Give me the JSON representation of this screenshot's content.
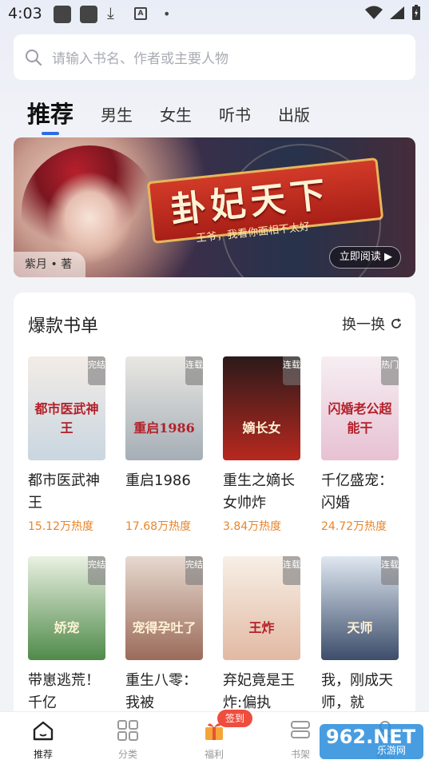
{
  "status_bar": {
    "time": "4:03"
  },
  "search": {
    "placeholder": "请输入书名、作者或主要人物"
  },
  "tabs": [
    {
      "label": "推荐",
      "active": true
    },
    {
      "label": "男生"
    },
    {
      "label": "女生"
    },
    {
      "label": "听书"
    },
    {
      "label": "出版"
    }
  ],
  "banner": {
    "title": "卦妃天下",
    "subtitle": "王爷，我看你面相不太好",
    "author": "紫月 • 著",
    "button_label": "立即阅读"
  },
  "booklist": {
    "title": "爆款书单",
    "refresh_label": "换一换",
    "books": [
      {
        "name": "都市医武神王",
        "heat": "15.12万热度",
        "badge": "完结",
        "cover_text": "都市医武神王",
        "cover_colors": [
          "#f3ece6",
          "#c9d6e0"
        ]
      },
      {
        "name": "重启1986",
        "heat": "17.68万热度",
        "badge": "连载",
        "cover_text": "重启1986",
        "cover_colors": [
          "#e9e7e2",
          "#a5aeb6"
        ]
      },
      {
        "name": "重生之嫡长女帅炸",
        "heat": "3.84万热度",
        "badge": "连载",
        "cover_text": "嫡长女",
        "cover_colors": [
          "#2a1a1a",
          "#b8281f"
        ]
      },
      {
        "name": "千亿盛宠：闪婚",
        "heat": "24.72万热度",
        "badge": "热门",
        "cover_text": "闪婚老公超能干",
        "cover_colors": [
          "#f6eef2",
          "#e7c1d2"
        ]
      },
      {
        "name": "带崽逃荒！千亿",
        "heat": "",
        "badge": "完结",
        "cover_text": "娇宠",
        "cover_colors": [
          "#eaf1e2",
          "#4f8a4a"
        ]
      },
      {
        "name": "重生八零：我被",
        "heat": "",
        "badge": "完结",
        "cover_text": "宠得孕吐了",
        "cover_colors": [
          "#e7d9cf",
          "#9b6b5a"
        ]
      },
      {
        "name": "弃妃竟是王炸:偏执",
        "heat": "",
        "badge": "连载",
        "cover_text": "王炸",
        "cover_colors": [
          "#f7efe6",
          "#e2b9a3"
        ]
      },
      {
        "name": "我，刚成天师，就",
        "heat": "",
        "badge": "连载",
        "cover_text": "天师",
        "cover_colors": [
          "#dfe7f1",
          "#3c4d6a"
        ]
      }
    ]
  },
  "bottom_nav": [
    {
      "label": "推荐",
      "icon": "home-icon",
      "active": true
    },
    {
      "label": "分类",
      "icon": "grid-icon"
    },
    {
      "label": "福利",
      "icon": "gift-icon"
    },
    {
      "label": "书架",
      "icon": "bookshelf-icon"
    },
    {
      "label": "我的",
      "icon": "user-icon"
    }
  ],
  "signin_badge": "签到",
  "watermark": {
    "number": "962.NET",
    "site": "乐游网"
  }
}
